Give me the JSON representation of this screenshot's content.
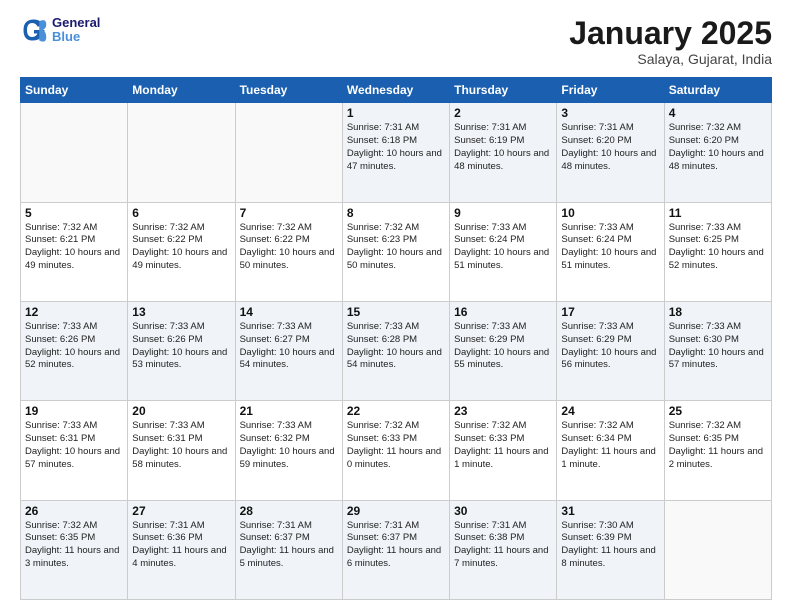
{
  "header": {
    "logo_line1": "General",
    "logo_line2": "Blue",
    "month_title": "January 2025",
    "subtitle": "Salaya, Gujarat, India"
  },
  "weekdays": [
    "Sunday",
    "Monday",
    "Tuesday",
    "Wednesday",
    "Thursday",
    "Friday",
    "Saturday"
  ],
  "weeks": [
    [
      {
        "day": "",
        "info": ""
      },
      {
        "day": "",
        "info": ""
      },
      {
        "day": "",
        "info": ""
      },
      {
        "day": "1",
        "info": "Sunrise: 7:31 AM\nSunset: 6:18 PM\nDaylight: 10 hours\nand 47 minutes."
      },
      {
        "day": "2",
        "info": "Sunrise: 7:31 AM\nSunset: 6:19 PM\nDaylight: 10 hours\nand 48 minutes."
      },
      {
        "day": "3",
        "info": "Sunrise: 7:31 AM\nSunset: 6:20 PM\nDaylight: 10 hours\nand 48 minutes."
      },
      {
        "day": "4",
        "info": "Sunrise: 7:32 AM\nSunset: 6:20 PM\nDaylight: 10 hours\nand 48 minutes."
      }
    ],
    [
      {
        "day": "5",
        "info": "Sunrise: 7:32 AM\nSunset: 6:21 PM\nDaylight: 10 hours\nand 49 minutes."
      },
      {
        "day": "6",
        "info": "Sunrise: 7:32 AM\nSunset: 6:22 PM\nDaylight: 10 hours\nand 49 minutes."
      },
      {
        "day": "7",
        "info": "Sunrise: 7:32 AM\nSunset: 6:22 PM\nDaylight: 10 hours\nand 50 minutes."
      },
      {
        "day": "8",
        "info": "Sunrise: 7:32 AM\nSunset: 6:23 PM\nDaylight: 10 hours\nand 50 minutes."
      },
      {
        "day": "9",
        "info": "Sunrise: 7:33 AM\nSunset: 6:24 PM\nDaylight: 10 hours\nand 51 minutes."
      },
      {
        "day": "10",
        "info": "Sunrise: 7:33 AM\nSunset: 6:24 PM\nDaylight: 10 hours\nand 51 minutes."
      },
      {
        "day": "11",
        "info": "Sunrise: 7:33 AM\nSunset: 6:25 PM\nDaylight: 10 hours\nand 52 minutes."
      }
    ],
    [
      {
        "day": "12",
        "info": "Sunrise: 7:33 AM\nSunset: 6:26 PM\nDaylight: 10 hours\nand 52 minutes."
      },
      {
        "day": "13",
        "info": "Sunrise: 7:33 AM\nSunset: 6:26 PM\nDaylight: 10 hours\nand 53 minutes."
      },
      {
        "day": "14",
        "info": "Sunrise: 7:33 AM\nSunset: 6:27 PM\nDaylight: 10 hours\nand 54 minutes."
      },
      {
        "day": "15",
        "info": "Sunrise: 7:33 AM\nSunset: 6:28 PM\nDaylight: 10 hours\nand 54 minutes."
      },
      {
        "day": "16",
        "info": "Sunrise: 7:33 AM\nSunset: 6:29 PM\nDaylight: 10 hours\nand 55 minutes."
      },
      {
        "day": "17",
        "info": "Sunrise: 7:33 AM\nSunset: 6:29 PM\nDaylight: 10 hours\nand 56 minutes."
      },
      {
        "day": "18",
        "info": "Sunrise: 7:33 AM\nSunset: 6:30 PM\nDaylight: 10 hours\nand 57 minutes."
      }
    ],
    [
      {
        "day": "19",
        "info": "Sunrise: 7:33 AM\nSunset: 6:31 PM\nDaylight: 10 hours\nand 57 minutes."
      },
      {
        "day": "20",
        "info": "Sunrise: 7:33 AM\nSunset: 6:31 PM\nDaylight: 10 hours\nand 58 minutes."
      },
      {
        "day": "21",
        "info": "Sunrise: 7:33 AM\nSunset: 6:32 PM\nDaylight: 10 hours\nand 59 minutes."
      },
      {
        "day": "22",
        "info": "Sunrise: 7:32 AM\nSunset: 6:33 PM\nDaylight: 11 hours\nand 0 minutes."
      },
      {
        "day": "23",
        "info": "Sunrise: 7:32 AM\nSunset: 6:33 PM\nDaylight: 11 hours\nand 1 minute."
      },
      {
        "day": "24",
        "info": "Sunrise: 7:32 AM\nSunset: 6:34 PM\nDaylight: 11 hours\nand 1 minute."
      },
      {
        "day": "25",
        "info": "Sunrise: 7:32 AM\nSunset: 6:35 PM\nDaylight: 11 hours\nand 2 minutes."
      }
    ],
    [
      {
        "day": "26",
        "info": "Sunrise: 7:32 AM\nSunset: 6:35 PM\nDaylight: 11 hours\nand 3 minutes."
      },
      {
        "day": "27",
        "info": "Sunrise: 7:31 AM\nSunset: 6:36 PM\nDaylight: 11 hours\nand 4 minutes."
      },
      {
        "day": "28",
        "info": "Sunrise: 7:31 AM\nSunset: 6:37 PM\nDaylight: 11 hours\nand 5 minutes."
      },
      {
        "day": "29",
        "info": "Sunrise: 7:31 AM\nSunset: 6:37 PM\nDaylight: 11 hours\nand 6 minutes."
      },
      {
        "day": "30",
        "info": "Sunrise: 7:31 AM\nSunset: 6:38 PM\nDaylight: 11 hours\nand 7 minutes."
      },
      {
        "day": "31",
        "info": "Sunrise: 7:30 AM\nSunset: 6:39 PM\nDaylight: 11 hours\nand 8 minutes."
      },
      {
        "day": "",
        "info": ""
      }
    ]
  ]
}
